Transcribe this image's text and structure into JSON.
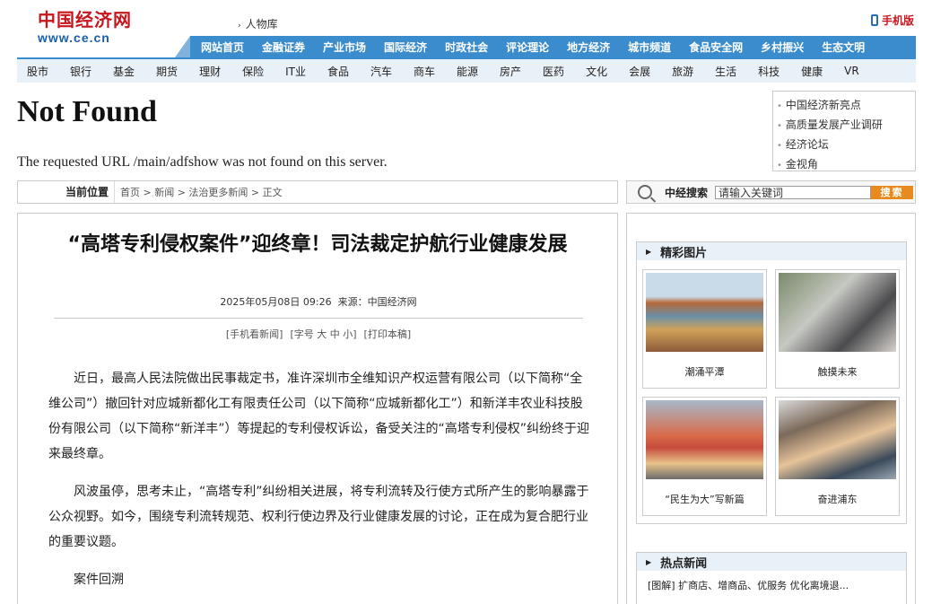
{
  "header": {
    "logo_cn": "中国经济网",
    "logo_url": "www.ce.cn",
    "people_link": "人物库",
    "mobile_label": "手机版"
  },
  "nav_primary": [
    "网站首页",
    "金融证券",
    "产业市场",
    "国际经济",
    "时政社会",
    "评论理论",
    "地方经济",
    "城市频道",
    "食品安全网",
    "乡村振兴",
    "生态文明"
  ],
  "nav_secondary": [
    "股市",
    "银行",
    "基金",
    "期货",
    "理财",
    "保险",
    "IT业",
    "食品",
    "汽车",
    "商车",
    "能源",
    "房产",
    "医药",
    "文化",
    "会展",
    "旅游",
    "生活",
    "科技",
    "健康",
    "VR"
  ],
  "not_found": {
    "title": "Not Found",
    "message": "The requested URL /main/adfshow was not found on this server."
  },
  "side_links": [
    "中国经济新亮点",
    "高质量发展产业调研",
    "经济论坛",
    "金视角"
  ],
  "breadcrumb": {
    "label": "当前位置",
    "path": "首页 > 新闻 > 法治更多新闻 > 正文"
  },
  "search": {
    "label": "中经搜索",
    "placeholder": "请输入关键词",
    "button": "搜索"
  },
  "article": {
    "title": "“高塔专利侵权案件”迎终章！司法裁定护航行业健康发展",
    "date": "2025年05月08日 09:26",
    "source": "来源：中国经济网",
    "tools": [
      "[手机看新闻]",
      "[字号 大 中 小]",
      "[打印本稿]"
    ],
    "paragraphs": [
      "近日，最高人民法院做出民事裁定书，准许深圳市全维知识产权运营有限公司（以下简称“全维公司”）撤回针对应城新都化工有限责任公司（以下简称“应城新都化工”）和新洋丰农业科技股份有限公司（以下简称“新洋丰”）等提起的专利侵权诉讼，备受关注的“高塔专利侵权”纠纷终于迎来最终章。",
      "风波虽停，思考未止，“高塔专利”纠纷相关进展，将专利流转及行使方式所产生的影响暴露于公众视野。如今，围绕专利流转规范、权利行使边界及行业健康发展的讨论，正在成为复合肥行业的重要议题。",
      "案件回溯"
    ]
  },
  "featured_pics": {
    "heading": "精彩图片",
    "items": [
      {
        "caption": "潮涌平潭"
      },
      {
        "caption": "触摸未来"
      },
      {
        "caption": "“民生为大”写新篇"
      },
      {
        "caption": "奋进浦东"
      }
    ]
  },
  "hot_news": {
    "heading": "热点新闻",
    "items": [
      "[图解] 扩商店、增商品、优服务 优化离境退..."
    ]
  }
}
